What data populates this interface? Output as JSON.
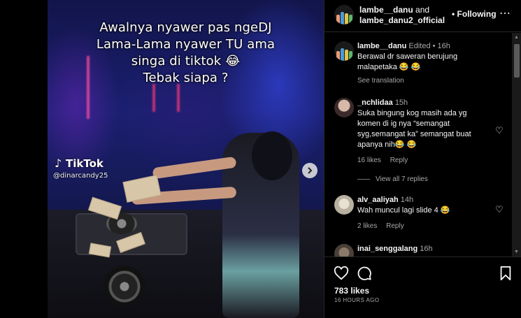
{
  "media": {
    "caption_lines": [
      "Awalnya nyawer pas ngeDJ",
      "Lama-Lama nyawer TU ama",
      "singa di tiktok 😂",
      "Tebak siapa ?"
    ],
    "watermark_brand": "TikTok",
    "watermark_handle": "@dinarcandy25",
    "next_icon": "chevron-right"
  },
  "header": {
    "user1": "lambe__danu",
    "and": " and",
    "user2": "lambe_danu2_official",
    "dot": "•",
    "follow_label": "Following",
    "more_icon": "⋯"
  },
  "comments": [
    {
      "user": "lambe__danu",
      "meta": "Edited • 16h",
      "text": "Berawal dr saweran berujung malapetaka 😂 😂",
      "see_translation": "See translation"
    },
    {
      "user": "_nchlidaa",
      "meta": "15h",
      "text": "Suka bingung kog masih ada yg komen di ig nya “semangat syg,semangat ka” semangat buat apanya nih😂 😂",
      "likes": "16 likes",
      "reply": "Reply",
      "view_replies": "View all 7 replies"
    },
    {
      "user": "alv_aaliyah",
      "meta": "14h",
      "text": "Wah muncul lagi slide 4 😂",
      "likes": "2 likes",
      "reply": "Reply"
    },
    {
      "user": "inai_senggalang",
      "meta": "16h"
    }
  ],
  "footer": {
    "likes": "783 likes",
    "time": "16 HOURS AGO"
  },
  "colors": {
    "background": "#000000",
    "text": "#f5f5f5",
    "muted": "#a8a8a8",
    "divider": "#262626"
  }
}
